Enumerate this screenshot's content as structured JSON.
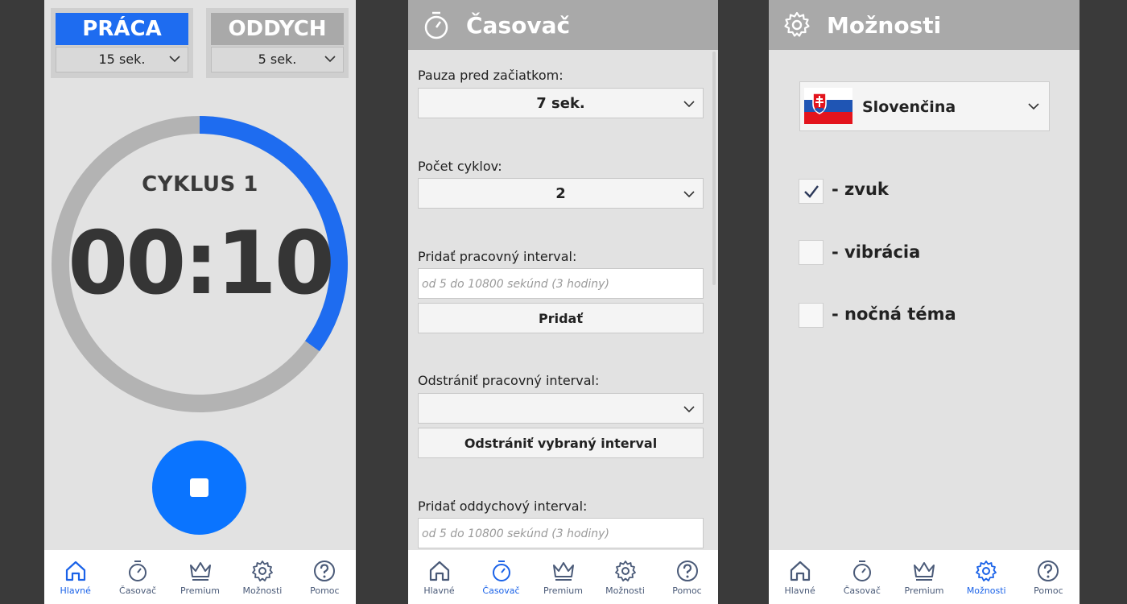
{
  "main": {
    "work": {
      "label": "PRÁCA",
      "value": "15 sek.",
      "color": "#1e6cf0"
    },
    "rest": {
      "label": "ODDYCH",
      "value": "5 sek.",
      "color": "#a9a9a9"
    },
    "cycle": "CYKLUS 1",
    "time": "00:10",
    "progress_fraction": 0.35,
    "progress_color": "#1e6cf0",
    "track_color": "#b3b3b3"
  },
  "timer": {
    "title": "Časovač",
    "pause_label": "Pauza pred začiatkom:",
    "pause_value": "7 sek.",
    "cycles_label": "Počet cyklov:",
    "cycles_value": "2",
    "add_work_label": "Pridať pracovný interval:",
    "add_work_placeholder": "od 5 do 10800 sekúnd (3 hodiny)",
    "add_button": "Pridať",
    "remove_work_label": "Odstrániť pracovný interval:",
    "remove_work_value": "",
    "remove_button": "Odstrániť vybraný interval",
    "add_rest_label": "Pridať oddychový interval:",
    "add_rest_placeholder": "od 5 do 10800 sekúnd (3 hodiny)"
  },
  "options": {
    "title": "Možnosti",
    "language": "Slovenčina",
    "sound": {
      "label": "- zvuk",
      "checked": true
    },
    "vibration": {
      "label": "- vibrácia",
      "checked": false
    },
    "night": {
      "label": "- nočná téma",
      "checked": false
    }
  },
  "nav": {
    "home": "Hlavné",
    "timer": "Časovač",
    "premium": "Premium",
    "options": "Možnosti",
    "help": "Pomoc"
  },
  "icons": [
    "home-icon",
    "stopwatch-icon",
    "crown-icon",
    "gear-icon",
    "help-icon",
    "chevron-down-icon",
    "checkmark-icon",
    "slovak-flag-icon"
  ]
}
